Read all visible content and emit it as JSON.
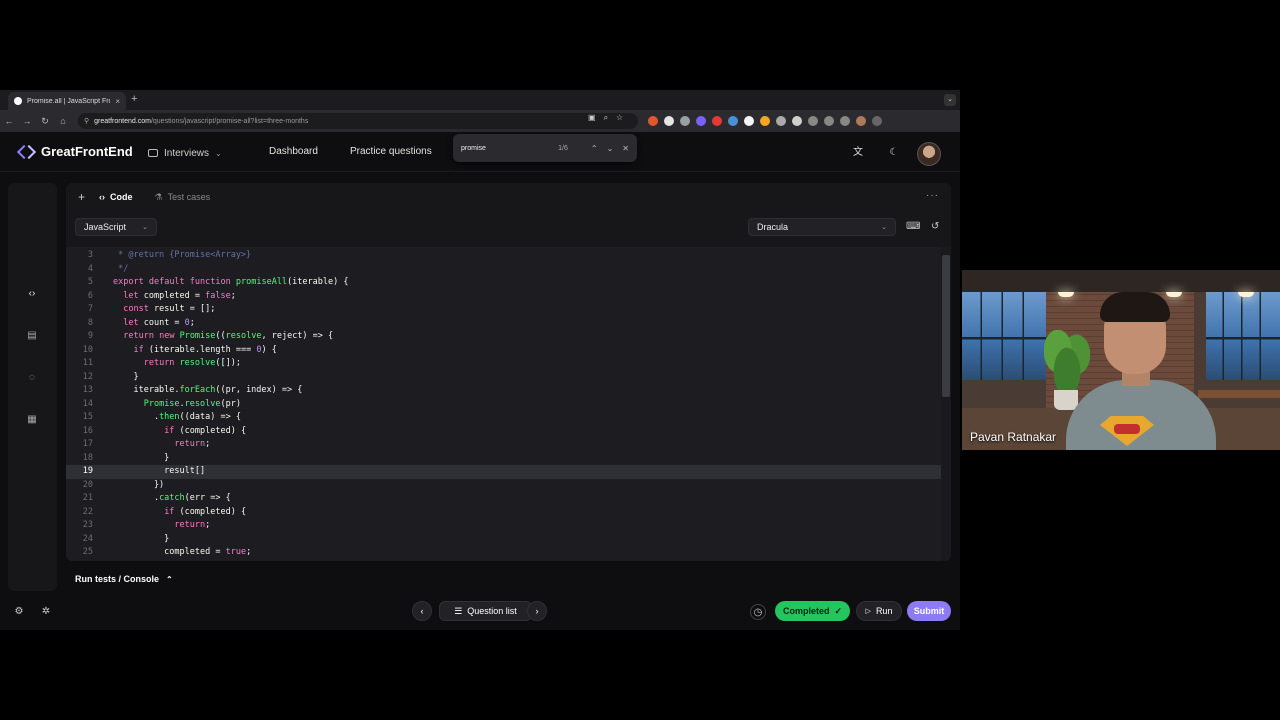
{
  "browser": {
    "tab_title": "Promise.all | JavaScript Front",
    "tab_close": "×",
    "new_tab": "+",
    "url_host": "greatfrontend.com",
    "url_path": "/questions/javascript/promise-all?list=three-months",
    "find": {
      "query": "promise",
      "count": "1/6"
    }
  },
  "header": {
    "brand": "GreatFrontEnd",
    "interviews": "Interviews",
    "nav": [
      "Dashboard",
      "Practice questions"
    ]
  },
  "panel": {
    "tabs": [
      {
        "label": "Code",
        "icon": "code-brackets-icon"
      },
      {
        "label": "Test cases",
        "icon": "flask-icon"
      }
    ],
    "more": "···",
    "language": "JavaScript",
    "theme": "Dracula"
  },
  "code": {
    "highlight_line": "19",
    "lines": [
      {
        "n": "3",
        "t": " * @return {Promise<Array>}"
      },
      {
        "n": "4",
        "t": " */"
      },
      {
        "n": "5",
        "t": "export default function promiseAll(iterable) {"
      },
      {
        "n": "6",
        "t": "  let completed = false;"
      },
      {
        "n": "7",
        "t": "  const result = [];"
      },
      {
        "n": "8",
        "t": "  let count = 0;"
      },
      {
        "n": "9",
        "t": "  return new Promise((resolve, reject) => {"
      },
      {
        "n": "10",
        "t": "    if (iterable.length === 0) {"
      },
      {
        "n": "11",
        "t": "      return resolve([]);"
      },
      {
        "n": "12",
        "t": "    }"
      },
      {
        "n": "13",
        "t": "    iterable.forEach((pr, index) => {"
      },
      {
        "n": "14",
        "t": "      Promise.resolve(pr)"
      },
      {
        "n": "15",
        "t": "        .then((data) => {"
      },
      {
        "n": "16",
        "t": "          if (completed) {"
      },
      {
        "n": "17",
        "t": "            return;"
      },
      {
        "n": "18",
        "t": "          }"
      },
      {
        "n": "19",
        "t": "          result[]"
      },
      {
        "n": "20",
        "t": "        })"
      },
      {
        "n": "21",
        "t": "        .catch(err => {"
      },
      {
        "n": "22",
        "t": "          if (completed) {"
      },
      {
        "n": "23",
        "t": "            return;"
      },
      {
        "n": "24",
        "t": "          }"
      },
      {
        "n": "25",
        "t": "          completed = true;"
      }
    ]
  },
  "console": {
    "label": "Run tests / Console"
  },
  "footer": {
    "question_list": "Question list",
    "completed": "Completed",
    "run": "Run",
    "submit": "Submit"
  },
  "webcam": {
    "name": "Pavan Ratnakar"
  },
  "colors": {
    "accent": "#8b7cf6",
    "completed": "#22c55e",
    "keyword": "#ff79c6",
    "function": "#50fa7b",
    "number": "#bd93f9",
    "comment": "#6272a4"
  }
}
